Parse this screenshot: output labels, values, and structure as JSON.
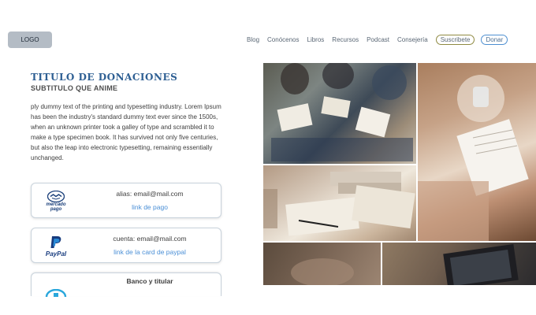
{
  "header": {
    "logo": "LOGO",
    "nav": [
      {
        "label": "Blog"
      },
      {
        "label": "Conócenos"
      },
      {
        "label": "Libros"
      },
      {
        "label": "Recursos"
      },
      {
        "label": "Podcast"
      },
      {
        "label": "Consejería"
      }
    ],
    "subscribe_label": "Suscribete",
    "donate_label": "Donar"
  },
  "main": {
    "title": "TITULO DE DONACIONES",
    "subtitle": "SUBTITULO QUE ANIME",
    "body": "ply dummy text of the printing and typesetting industry. Lorem Ipsum has been the industry's standard dummy text ever since the 1500s, when an unknown printer took a galley of type and scrambled it to make a type specimen book. It has survived not only five centuries, but also the leap into electronic typesetting, remaining essentially unchanged."
  },
  "payments": [
    {
      "logo_text": "mercado pago",
      "icon": "mercado-pago-icon",
      "line1": "alias: email@mail.com",
      "line2": "link de pago"
    },
    {
      "logo_text": "PayPal",
      "icon": "paypal-icon",
      "line1": "cuenta: email@mail.com",
      "line2": "link de la card de paypal"
    },
    {
      "icon": "bank-icon",
      "line1": "Banco y titular"
    }
  ],
  "colors": {
    "accent": "#2e5f93",
    "link": "#4a8fd6",
    "subscribe_border": "#8f8a42",
    "donate_border": "#4d8fd1"
  }
}
